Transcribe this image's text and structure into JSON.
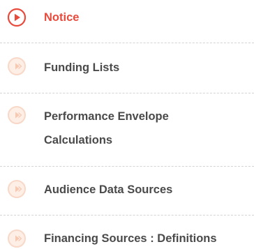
{
  "menu": {
    "items": [
      {
        "label": "Notice",
        "active": true,
        "icon": "play-circle-icon"
      },
      {
        "label": "Funding Lists",
        "active": false,
        "icon": "play-circle-icon"
      },
      {
        "label_line1": "Performance Envelope",
        "label_line2": "Calculations",
        "active": false,
        "icon": "play-circle-icon"
      },
      {
        "label": "Audience Data Sources",
        "active": false,
        "icon": "play-circle-icon"
      },
      {
        "label": "Financing Sources : Definitions",
        "active": false,
        "icon": "play-circle-icon"
      }
    ]
  },
  "colors": {
    "active_text": "#e84a3c",
    "active_icon": "#e84a3c",
    "inactive_text": "#4a4a4a",
    "inactive_icon_ring": "#f8d8c8",
    "inactive_icon_fill": "#fdeee6",
    "divider": "#d4d4d4"
  }
}
